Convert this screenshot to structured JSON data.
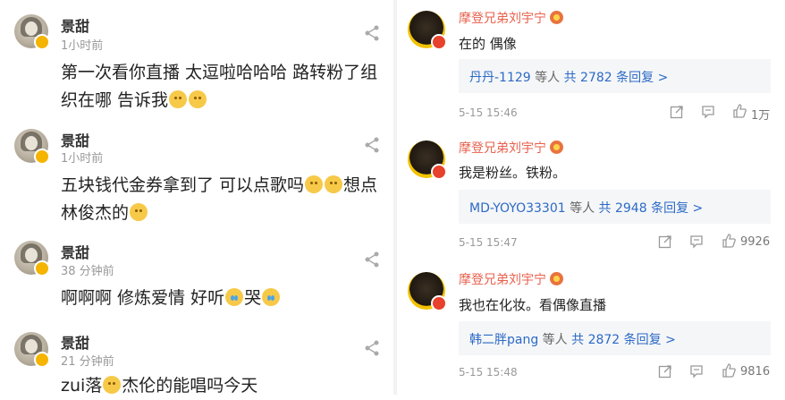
{
  "left": {
    "comments": [
      {
        "name": "景甜",
        "time": "1小时前",
        "text": "第一次看你直播 太逗啦哈哈哈 路转粉了组织在哪 告诉我"
      },
      {
        "name": "景甜",
        "time": "1小时前",
        "text": "五块钱代金券拿到了 可以点歌吗",
        "text2": "想点 林俊杰的"
      },
      {
        "name": "景甜",
        "time": "38 分钟前",
        "text": "啊啊啊 修炼爱情 好听",
        "text2": "哭"
      },
      {
        "name": "景甜",
        "time": "21 分钟前",
        "text": "zui落",
        "text2": "杰伦的能唱吗今天"
      }
    ]
  },
  "right": {
    "comments": [
      {
        "name": "摩登兄弟刘宇宁",
        "text": "在的 偶像",
        "reply_user": "丹丹-1129",
        "reply_mid": " 等人 ",
        "reply_count": "共 2782 条回复 >",
        "date": "5-15 15:46",
        "likes": "1万"
      },
      {
        "name": "摩登兄弟刘宇宁",
        "text": "我是粉丝。铁粉。",
        "reply_user": "MD-YOYO33301",
        "reply_mid": " 等人 ",
        "reply_count": "共 2948 条回复 >",
        "date": "5-15 15:47",
        "likes": "9926"
      },
      {
        "name": "摩登兄弟刘宇宁",
        "text": "我也在化妆。看偶像直播",
        "reply_user": "韩二胖pang",
        "reply_mid": " 等人 ",
        "reply_count": "共 2872 条回复 >",
        "date": "5-15 15:48",
        "likes": "9816"
      }
    ]
  },
  "icons": {
    "share": "share-icon",
    "repost": "repost-icon",
    "comment": "comment-icon",
    "like": "thumbs-up-icon",
    "verified": "verified-badge-icon"
  },
  "colors": {
    "name_red": "#e8614d",
    "link_blue": "#2c6ac6",
    "meta_gray": "#999999",
    "reply_bg": "#f5f6f8"
  }
}
